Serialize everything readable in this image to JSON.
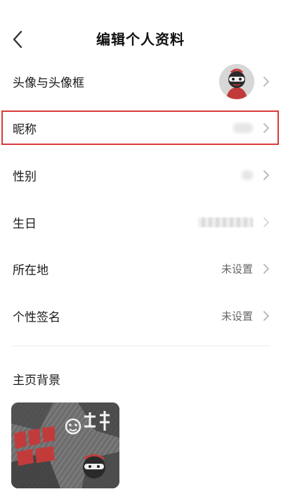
{
  "header": {
    "title": "编辑个人资料",
    "back_icon": "chevron-left-icon"
  },
  "rows": [
    {
      "label": "头像与头像框",
      "value": ""
    },
    {
      "label": "昵称",
      "value": ""
    },
    {
      "label": "性别",
      "value": ""
    },
    {
      "label": "生日",
      "value": ""
    },
    {
      "label": "所在地",
      "value": "未设置"
    },
    {
      "label": "个性签名",
      "value": "未设置"
    }
  ],
  "background_section": {
    "title": "主页背景"
  },
  "colors": {
    "highlight_border": "#d93a3a",
    "chevron": "#b5b5b5",
    "value_text": "#666666"
  }
}
